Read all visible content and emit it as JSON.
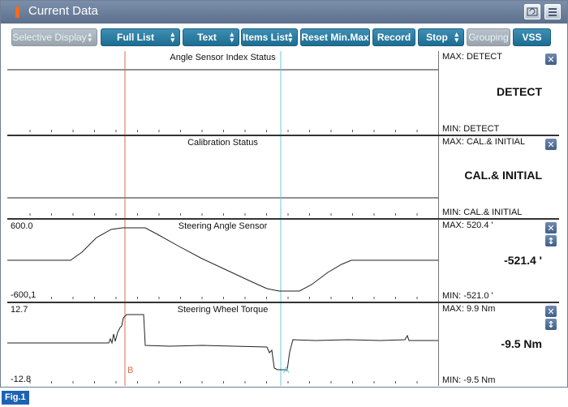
{
  "window": {
    "title": "Current Data"
  },
  "toolbar": {
    "selective_display": "Selective Display",
    "full_list": "Full List",
    "text": "Text",
    "items_list": "Items List",
    "reset_minmax": "Reset Min.Max",
    "record": "Record",
    "stop": "Stop",
    "grouping": "Grouping",
    "vss": "VSS"
  },
  "panels": [
    {
      "title": "Angle Sensor Index Status",
      "max": "MAX: DETECT",
      "min": "MIN: DETECT",
      "value": "DETECT",
      "ymax": "",
      "ymin": ""
    },
    {
      "title": "Calibration Status",
      "max": "MAX: CAL.& INITIAL",
      "min": "MIN: CAL.& INITIAL",
      "value": "CAL.& INITIAL",
      "ymax": "",
      "ymin": ""
    },
    {
      "title": "Steering Angle Sensor",
      "max": "MAX: 520.4 '",
      "min": "MIN: -521.0 '",
      "value": "-521.4 '",
      "ymax": "600.0",
      "ymin": "-600.1"
    },
    {
      "title": "Steering Wheel Torque",
      "max": "MAX:   9.9 Nm",
      "min": "MIN:  -9.5 Nm",
      "value": "-9.5 Nm",
      "ymax": "12.7",
      "ymin": "-12.8"
    }
  ],
  "cursors": {
    "b_label": "B",
    "a_label": "A"
  },
  "colors": {
    "cursor_b": "#e06a4a",
    "cursor_a": "#6cc7d9",
    "button": "#2a7ea6"
  },
  "figure_label": "Fig.1"
}
